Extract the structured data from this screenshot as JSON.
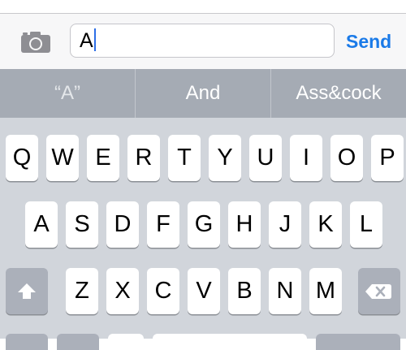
{
  "compose": {
    "text_value": "A",
    "send_label": "Send"
  },
  "suggestions": [
    "“A”",
    "And",
    "Ass&cock"
  ],
  "keyboard": {
    "row1": [
      "Q",
      "W",
      "E",
      "R",
      "T",
      "Y",
      "U",
      "I",
      "O",
      "P"
    ],
    "row2": [
      "A",
      "S",
      "D",
      "F",
      "G",
      "H",
      "J",
      "K",
      "L"
    ],
    "row3": [
      "Z",
      "X",
      "C",
      "V",
      "B",
      "N",
      "M"
    ]
  },
  "colors": {
    "send": "#1a7ae8",
    "caret": "#2d6ee6",
    "suggestion_bar": "#a5abb4",
    "keyboard_bg": "#d1d5db"
  },
  "icons": [
    "camera-icon",
    "shift-arrow-icon",
    "backspace-icon"
  ]
}
